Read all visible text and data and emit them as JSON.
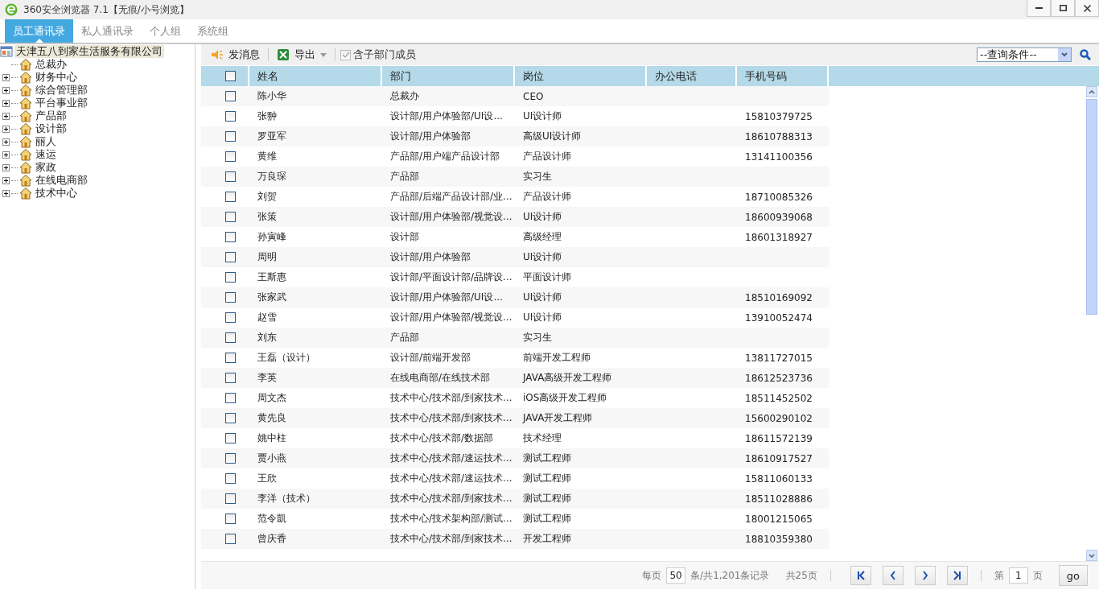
{
  "window": {
    "title": "360安全浏览器 7.1【无痕/小号浏览】"
  },
  "tabs": [
    {
      "label": "员工通讯录",
      "selected": true
    },
    {
      "label": "私人通讯录",
      "selected": false
    },
    {
      "label": "个人组",
      "selected": false
    },
    {
      "label": "系统组",
      "selected": false
    }
  ],
  "tree": {
    "label": "天津五八到家生活服务有限公司",
    "selected": true,
    "children": [
      {
        "label": "总裁办",
        "kind": "leaf",
        "selected": false
      },
      {
        "label": "财务中心",
        "kind": "branch",
        "selected": false
      },
      {
        "label": "综合管理部",
        "kind": "branch",
        "selected": false
      },
      {
        "label": "平台事业部",
        "kind": "branch",
        "selected": false
      },
      {
        "label": "产品部",
        "kind": "branch",
        "selected": false
      },
      {
        "label": "设计部",
        "kind": "branch",
        "selected": false
      },
      {
        "label": "丽人",
        "kind": "branch",
        "selected": false
      },
      {
        "label": "速运",
        "kind": "branch",
        "selected": false
      },
      {
        "label": "家政",
        "kind": "branch",
        "selected": false
      },
      {
        "label": "在线电商部",
        "kind": "branch",
        "selected": false
      },
      {
        "label": "技术中心",
        "kind": "branch",
        "selected": false
      }
    ]
  },
  "toolbar": {
    "send_message": "发消息",
    "export": "导出",
    "include_sub": {
      "label": "含子部门成员",
      "checked": true
    },
    "query": {
      "value": "--查询条件--"
    }
  },
  "table": {
    "select_all": {
      "checked": false
    },
    "columns": [
      "姓名",
      "部门",
      "岗位",
      "办公电话",
      "手机号码"
    ],
    "rows": [
      {
        "checked": false,
        "cells": [
          "陈小华",
          "总裁办",
          "CEO",
          "",
          ""
        ]
      },
      {
        "checked": false,
        "cells": [
          "张翀",
          "设计部/用户体验部/UI设...",
          "UI设计师",
          "",
          "15810379725"
        ]
      },
      {
        "checked": false,
        "cells": [
          "罗亚军",
          "设计部/用户体验部",
          "高级UI设计师",
          "",
          "18610788313"
        ]
      },
      {
        "checked": false,
        "cells": [
          "黄维",
          "产品部/用户端产品设计部",
          "产品设计师",
          "",
          "13141100356"
        ]
      },
      {
        "checked": false,
        "cells": [
          "万良琛",
          "产品部",
          "实习生",
          "",
          ""
        ]
      },
      {
        "checked": false,
        "cells": [
          "刘贺",
          "产品部/后端产品设计部/业...",
          "产品设计师",
          "",
          "18710085326"
        ]
      },
      {
        "checked": false,
        "cells": [
          "张策",
          "设计部/用户体验部/视觉设...",
          "UI设计师",
          "",
          "18600939068"
        ]
      },
      {
        "checked": false,
        "cells": [
          "孙寅峰",
          "设计部",
          "高级经理",
          "",
          "18601318927"
        ]
      },
      {
        "checked": false,
        "cells": [
          "周明",
          "设计部/用户体验部",
          "UI设计师",
          "",
          ""
        ]
      },
      {
        "checked": false,
        "cells": [
          "王斯惠",
          "设计部/平面设计部/品牌设...",
          "平面设计师",
          "",
          ""
        ]
      },
      {
        "checked": false,
        "cells": [
          "张家武",
          "设计部/用户体验部/UI设...",
          "UI设计师",
          "",
          "18510169092"
        ]
      },
      {
        "checked": false,
        "cells": [
          "赵雪",
          "设计部/用户体验部/视觉设...",
          "UI设计师",
          "",
          "13910052474"
        ]
      },
      {
        "checked": false,
        "cells": [
          "刘东",
          "产品部",
          "实习生",
          "",
          ""
        ]
      },
      {
        "checked": false,
        "cells": [
          "王磊（设计）",
          "设计部/前端开发部",
          "前端开发工程师",
          "",
          "13811727015"
        ]
      },
      {
        "checked": false,
        "cells": [
          "李英",
          "在线电商部/在线技术部",
          "JAVA高级开发工程师",
          "",
          "18612523736"
        ]
      },
      {
        "checked": false,
        "cells": [
          "周文杰",
          "技术中心/技术部/到家技术...",
          "iOS高级开发工程师",
          "",
          "18511452502"
        ]
      },
      {
        "checked": false,
        "cells": [
          "黄先良",
          "技术中心/技术部/到家技术...",
          "JAVA开发工程师",
          "",
          "15600290102"
        ]
      },
      {
        "checked": false,
        "cells": [
          "姚中柱",
          "技术中心/技术部/数据部",
          "技术经理",
          "",
          "18611572139"
        ]
      },
      {
        "checked": false,
        "cells": [
          "贾小燕",
          "技术中心/技术部/速运技术...",
          "测试工程师",
          "",
          "18610917527"
        ]
      },
      {
        "checked": false,
        "cells": [
          "王欣",
          "技术中心/技术部/速运技术...",
          "测试工程师",
          "",
          "15811060133"
        ]
      },
      {
        "checked": false,
        "cells": [
          "李洋（技术）",
          "技术中心/技术部/到家技术...",
          "测试工程师",
          "",
          "18511028886"
        ]
      },
      {
        "checked": false,
        "cells": [
          "范令凱",
          "技术中心/技术架构部/测试...",
          "测试工程师",
          "",
          "18001215065"
        ]
      },
      {
        "checked": false,
        "cells": [
          "曾庆香",
          "技术中心/技术部/到家技术...",
          "开发工程师",
          "",
          "18810359380"
        ]
      }
    ]
  },
  "pager": {
    "per_page_label": "每页",
    "per_page": "50",
    "records": "条/共1,201条记录",
    "pages": "共25页",
    "page_prefix": "第",
    "page": "1",
    "page_suffix": "页",
    "go": "go"
  }
}
